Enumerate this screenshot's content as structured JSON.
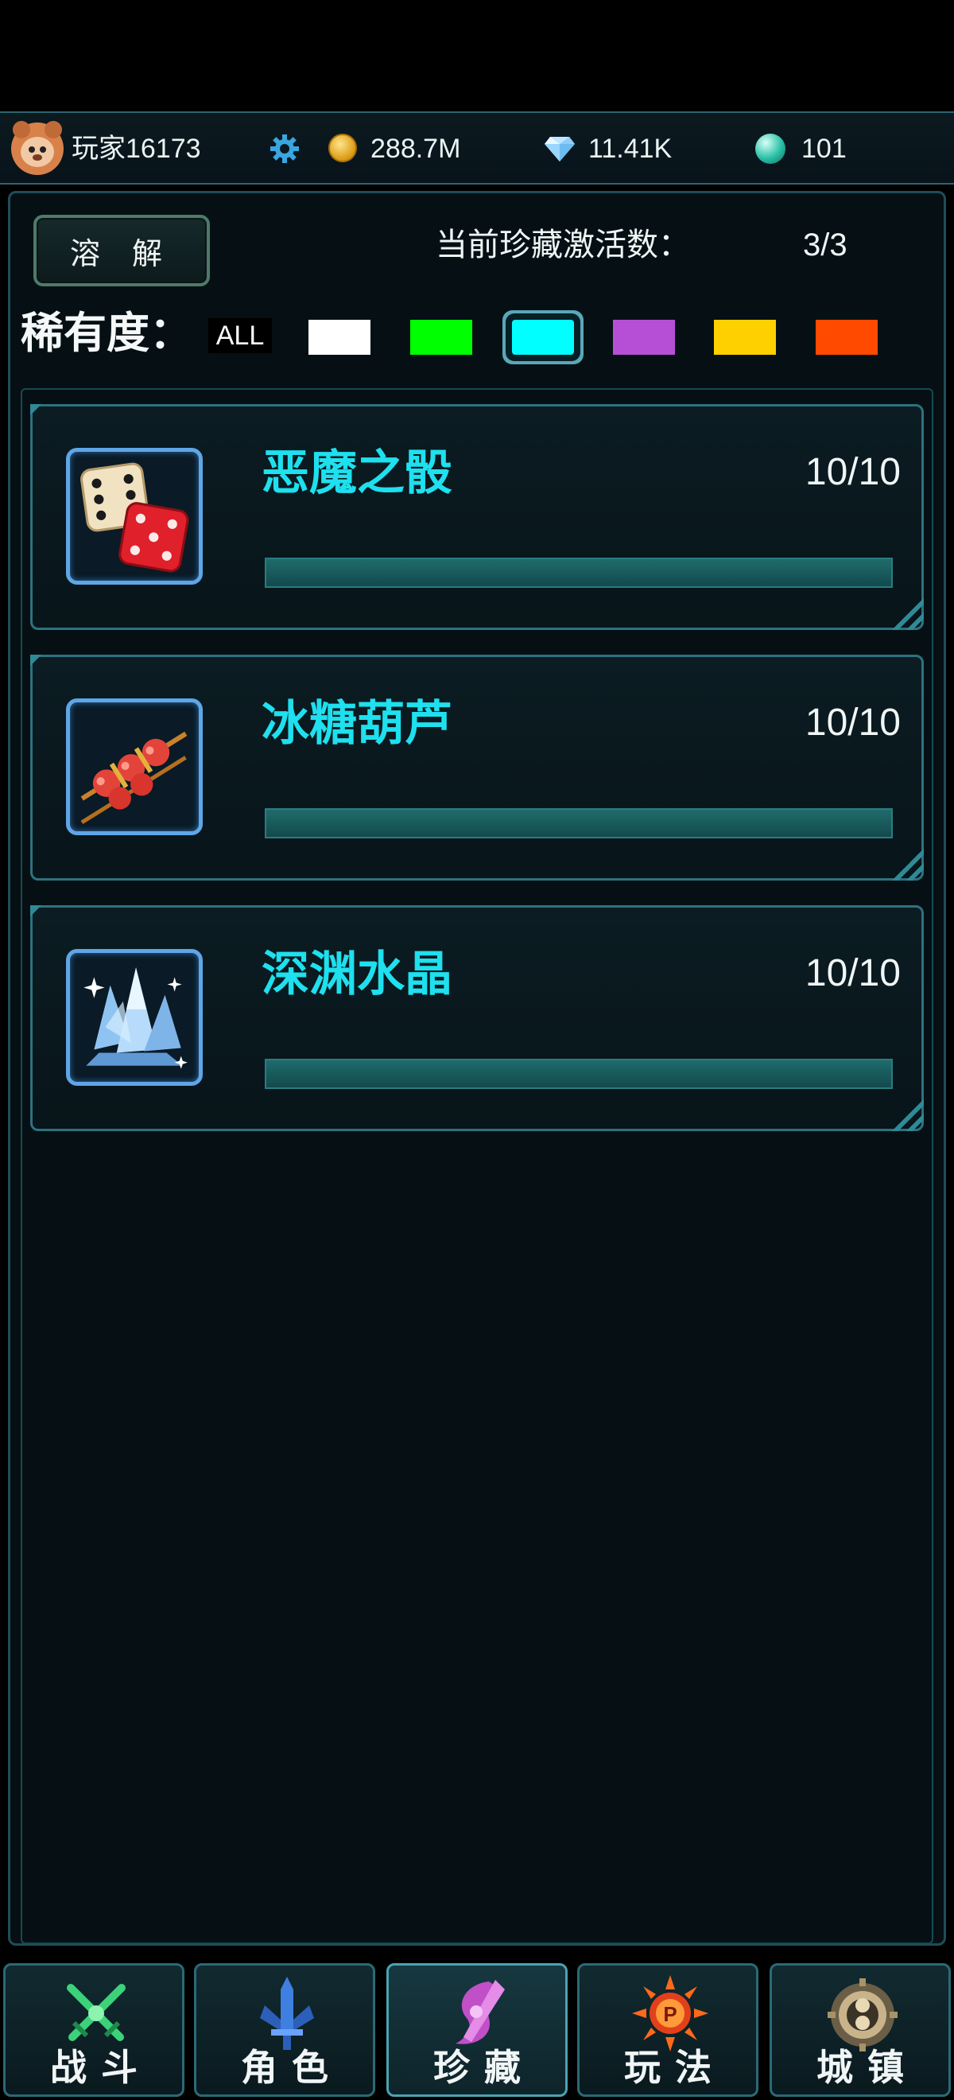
{
  "statusbar": {
    "player_name": "玩家16173",
    "gold": "288.7M",
    "diamonds": "11.41K",
    "orbs": "101",
    "icons": [
      "avatar-bear",
      "gear-icon",
      "gold-coin-icon",
      "diamond-icon",
      "green-orb-icon"
    ]
  },
  "toolbar": {
    "dissolve_label": "溶 解",
    "active_label": "当前珍藏激活数：",
    "active_value": "3/3"
  },
  "rarity": {
    "label": "稀有度：",
    "all_label": "ALL",
    "swatches": [
      {
        "name": "white",
        "color": "#ffffff"
      },
      {
        "name": "green",
        "color": "#00ff00"
      },
      {
        "name": "cyan",
        "color": "#00ffff",
        "selected": true
      },
      {
        "name": "purple",
        "color": "#b64fd6"
      },
      {
        "name": "yellow",
        "color": "#ffd000"
      },
      {
        "name": "orange",
        "color": "#ff4a00"
      }
    ]
  },
  "items": [
    {
      "name": "恶魔之骰",
      "count": "10/10",
      "progress": 1.0,
      "icon": "dice-icon"
    },
    {
      "name": "冰糖葫芦",
      "count": "10/10",
      "progress": 1.0,
      "icon": "candied-haws-icon"
    },
    {
      "name": "深渊水晶",
      "count": "10/10",
      "progress": 1.0,
      "icon": "crystal-icon"
    }
  ],
  "nav": {
    "tabs": [
      {
        "label": "战斗",
        "icon": "crossed-swords-icon"
      },
      {
        "label": "角色",
        "icon": "character-sword-icon"
      },
      {
        "label": "珍藏",
        "icon": "treasure-emblem-icon",
        "active": true
      },
      {
        "label": "玩法",
        "icon": "gameplay-emblem-icon"
      },
      {
        "label": "城镇",
        "icon": "town-emblem-icon"
      }
    ]
  }
}
